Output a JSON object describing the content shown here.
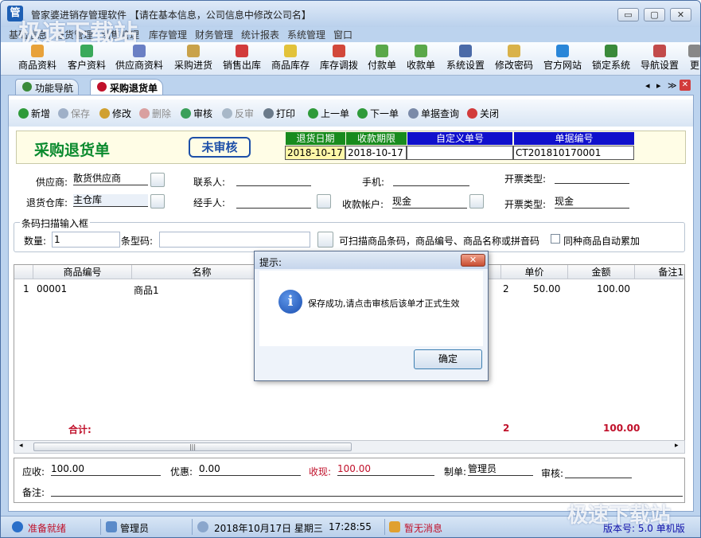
{
  "window": {
    "title": "管家婆进销存管理软件 【请在基本信息，公司信息中修改公司名】",
    "app_icon": "管",
    "controls": {
      "minimize": "▭",
      "maximize": "▢",
      "close": "✕"
    }
  },
  "watermark": {
    "top": "极速下载站",
    "bottom": "极速下载站"
  },
  "menu": [
    "基础信息",
    "进货管理",
    "销售管理",
    "库存管理",
    "财务管理",
    "统计报表",
    "系统管理",
    "窗口"
  ],
  "toolbar": [
    {
      "label": "商品资料",
      "icon": "goods-icon",
      "color": "#e8a23a"
    },
    {
      "label": "客户资料",
      "icon": "customer-icon",
      "color": "#3aa95a"
    },
    {
      "label": "供应商资料",
      "icon": "supplier-icon",
      "color": "#6a7fc4"
    },
    {
      "label": "采购进货",
      "icon": "purchase-icon",
      "color": "#c9a24a"
    },
    {
      "label": "销售出库",
      "icon": "sale-icon",
      "color": "#d23b3b"
    },
    {
      "label": "商品库存",
      "icon": "stock-icon",
      "color": "#e2c23a"
    },
    {
      "label": "库存调拨",
      "icon": "transfer-icon",
      "color": "#d2483a"
    },
    {
      "label": "付款单",
      "icon": "payment-icon",
      "color": "#5aa84a"
    },
    {
      "label": "收款单",
      "icon": "receipt-icon",
      "color": "#5aa84a"
    },
    {
      "label": "系统设置",
      "icon": "settings-icon",
      "color": "#4a6aa8"
    },
    {
      "label": "修改密码",
      "icon": "password-icon",
      "color": "#d9b24a"
    },
    {
      "label": "官方网站",
      "icon": "website-icon",
      "color": "#2a86d8"
    },
    {
      "label": "锁定系统",
      "icon": "lock-icon",
      "color": "#3a8a3a"
    },
    {
      "label": "导航设置",
      "icon": "nav-settings-icon",
      "color": "#c24a4a"
    },
    {
      "label": "更",
      "icon": "more-icon",
      "color": "#888888"
    }
  ],
  "tabs": [
    {
      "label": "功能导航",
      "icon": "home-icon",
      "color": "#3a8a3a"
    },
    {
      "label": "采购退货单",
      "icon": "doc-icon",
      "color": "#c0102a"
    }
  ],
  "tab_controls": {
    "prev": "◂",
    "next": "▸",
    "list": "≫",
    "close": "✕"
  },
  "actions": [
    {
      "label": "新增",
      "icon": "add-icon",
      "color": "#2e9a3a",
      "enabled": true
    },
    {
      "label": "保存",
      "icon": "save-icon",
      "color": "#9fb0c8",
      "enabled": false
    },
    {
      "label": "修改",
      "icon": "edit-icon",
      "color": "#d0a030",
      "enabled": true
    },
    {
      "label": "删除",
      "icon": "delete-icon",
      "color": "#d9a0a0",
      "enabled": false
    },
    {
      "label": "审核",
      "icon": "approve-icon",
      "color": "#3aa05a",
      "enabled": true
    },
    {
      "label": "反审",
      "icon": "unapprove-icon",
      "color": "#a8b8c8",
      "enabled": false
    },
    {
      "label": "打印",
      "icon": "print-icon",
      "color": "#6a7a8a",
      "enabled": true
    },
    {
      "label": "上一单",
      "icon": "prev-icon",
      "color": "#2e9a3a",
      "enabled": true
    },
    {
      "label": "下一单",
      "icon": "next-icon",
      "color": "#2e9a3a",
      "enabled": true
    },
    {
      "label": "单据查询",
      "icon": "query-icon",
      "color": "#7a8aa8",
      "enabled": true
    },
    {
      "label": "关闭",
      "icon": "close-doc-icon",
      "color": "#d23b3b",
      "enabled": true
    }
  ],
  "doc": {
    "title": "采购退货单",
    "stamp": "未审核",
    "headers": [
      "退货日期",
      "收款期限",
      "自定义单号",
      "单据编号"
    ],
    "values": [
      "2018-10-17",
      "2018-10-17",
      "",
      "CT201810170001"
    ]
  },
  "form": {
    "supplier_label": "供应商:",
    "supplier": "散货供应商",
    "contact_label": "联系人:",
    "contact": "",
    "phone_label": "手机:",
    "phone": "",
    "invoice_type_label": "开票类型:",
    "invoice_type": "",
    "warehouse_label": "退货仓库:",
    "warehouse": "主仓库",
    "handler_label": "经手人:",
    "handler": "",
    "account_label": "收款帐户:",
    "account": "现金",
    "invoice_type2_label": "开票类型:",
    "invoice_type2": "现金"
  },
  "scan": {
    "group_title": "条码扫描输入框",
    "qty_label": "数量:",
    "qty": "1",
    "barcode_label": "条型码:",
    "barcode": "",
    "hint": "可扫描商品条码，商品编号、商品名称或拼音码",
    "auto_label": "同种商品自动累加",
    "auto_checked": false
  },
  "grid": {
    "columns": [
      "商品编号",
      "名称",
      "单价",
      "金额",
      "备注1"
    ],
    "rows": [
      {
        "idx": "1",
        "code": "00001",
        "name": "商品1",
        "qty": "2",
        "price": "50.00",
        "amount": "100.00"
      }
    ],
    "total_label": "合计:",
    "total_qty": "2",
    "total_amount": "100.00",
    "scroll_thumb": "|||"
  },
  "footer": {
    "receivable_label": "应收:",
    "receivable": "100.00",
    "discount_label": "优惠:",
    "discount": "0.00",
    "received_label": "收现:",
    "received": "100.00",
    "maker_label": "制单:",
    "maker": "管理员",
    "auditor_label": "审核:",
    "auditor": "",
    "remark_label": "备注:",
    "remark": ""
  },
  "status": {
    "ready": "准备就绪",
    "user": "管理员",
    "datetime": "2018年10月17日 星期三",
    "time": "17:28:55",
    "messages": "暂无消息",
    "version": "版本号: 5.0 单机版"
  },
  "dialog": {
    "title": "提示:",
    "message": "保存成功,请点击审核后该单才正式生效",
    "ok": "确定",
    "icon": "i"
  }
}
